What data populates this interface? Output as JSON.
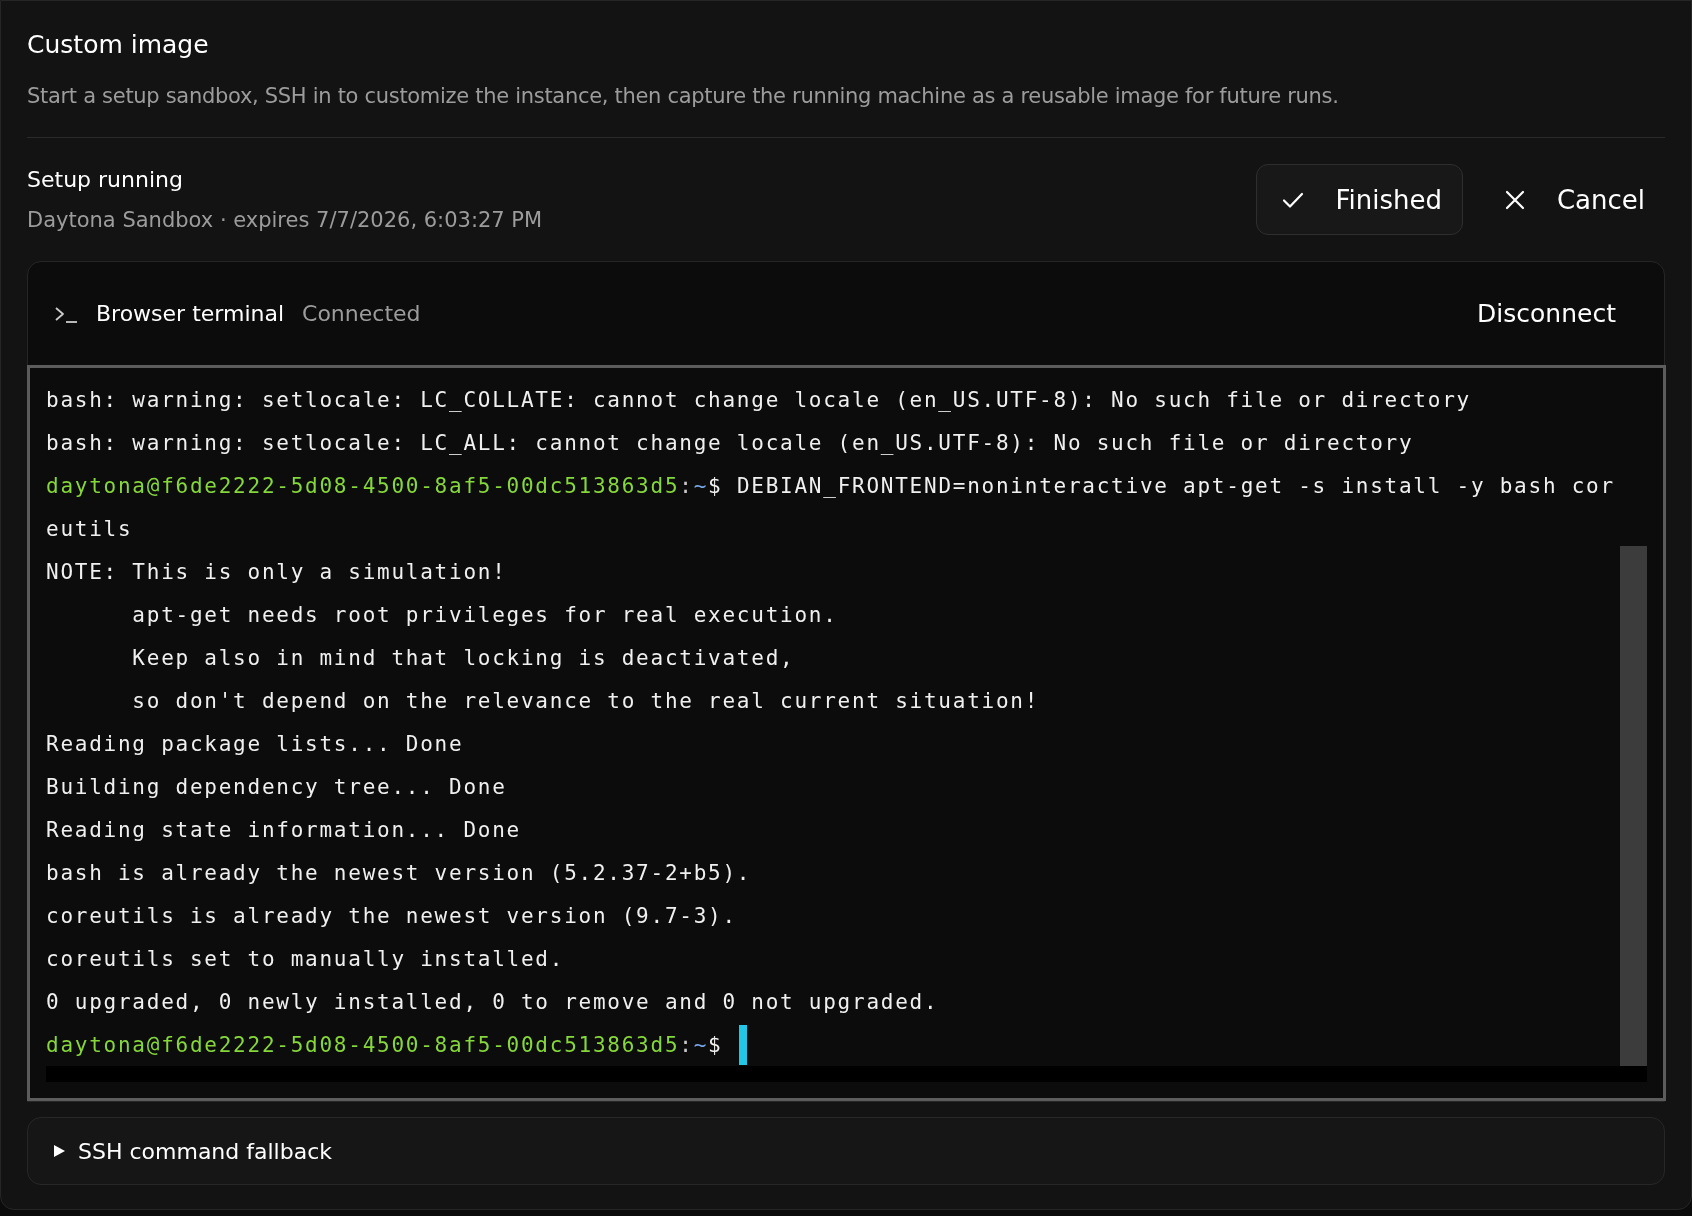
{
  "panel": {
    "title": "Custom image",
    "description": "Start a setup sandbox, SSH in to customize the instance, then capture the running machine as a reusable image for future runs."
  },
  "setup": {
    "status": "Setup running",
    "details": "Daytona Sandbox · expires 7/7/2026, 6:03:27 PM",
    "actions": [
      {
        "kind": "finish",
        "label": "Finished"
      },
      {
        "kind": "cancel",
        "label": "Cancel"
      }
    ]
  },
  "terminal": {
    "title": "Browser terminal",
    "state": "Connected",
    "action": "Disconnect",
    "cursor_visible": true,
    "lines": [
      {
        "segments": [
          {
            "kind": "plain",
            "text": "bash: warning: setlocale: LC_COLLATE: cannot change locale (en_US.UTF-8): No such file or directory"
          }
        ]
      },
      {
        "segments": [
          {
            "kind": "plain",
            "text": "bash: warning: setlocale: LC_ALL: cannot change locale (en_US.UTF-8): No such file or directory"
          }
        ]
      },
      {
        "segments": [
          {
            "kind": "user",
            "text": "daytona@f6de2222-5d08-4500-8af5-00dc513863d5"
          },
          {
            "kind": "separator",
            "text": ":"
          },
          {
            "kind": "path",
            "text": "~"
          },
          {
            "kind": "plain",
            "text": "$ DEBIAN_FRONTEND=noninteractive apt-get -s install -y bash cor"
          }
        ]
      },
      {
        "segments": [
          {
            "kind": "plain",
            "text": "eutils"
          }
        ]
      },
      {
        "segments": [
          {
            "kind": "plain",
            "text": "NOTE: This is only a simulation!"
          }
        ]
      },
      {
        "segments": [
          {
            "kind": "plain",
            "text": "      apt-get needs root privileges for real execution."
          }
        ]
      },
      {
        "segments": [
          {
            "kind": "plain",
            "text": "      Keep also in mind that locking is deactivated,"
          }
        ]
      },
      {
        "segments": [
          {
            "kind": "plain",
            "text": "      so don't depend on the relevance to the real current situation!"
          }
        ]
      },
      {
        "segments": [
          {
            "kind": "plain",
            "text": "Reading package lists... Done"
          }
        ]
      },
      {
        "segments": [
          {
            "kind": "plain",
            "text": "Building dependency tree... Done"
          }
        ]
      },
      {
        "segments": [
          {
            "kind": "plain",
            "text": "Reading state information... Done"
          }
        ]
      },
      {
        "segments": [
          {
            "kind": "plain",
            "text": "bash is already the newest version (5.2.37-2+b5)."
          }
        ]
      },
      {
        "segments": [
          {
            "kind": "plain",
            "text": "coreutils is already the newest version (9.7-3)."
          }
        ]
      },
      {
        "segments": [
          {
            "kind": "plain",
            "text": "coreutils set to manually installed."
          }
        ]
      },
      {
        "segments": [
          {
            "kind": "plain",
            "text": "0 upgraded, 0 newly installed, 0 to remove and 0 not upgraded."
          }
        ]
      },
      {
        "segments": [
          {
            "kind": "user",
            "text": "daytona@f6de2222-5d08-4500-8af5-00dc513863d5"
          },
          {
            "kind": "separator",
            "text": ":"
          },
          {
            "kind": "path",
            "text": "~"
          },
          {
            "kind": "plain",
            "text": "$"
          }
        ]
      }
    ]
  },
  "fallback": {
    "label": "SSH command fallback",
    "expanded": false
  }
}
